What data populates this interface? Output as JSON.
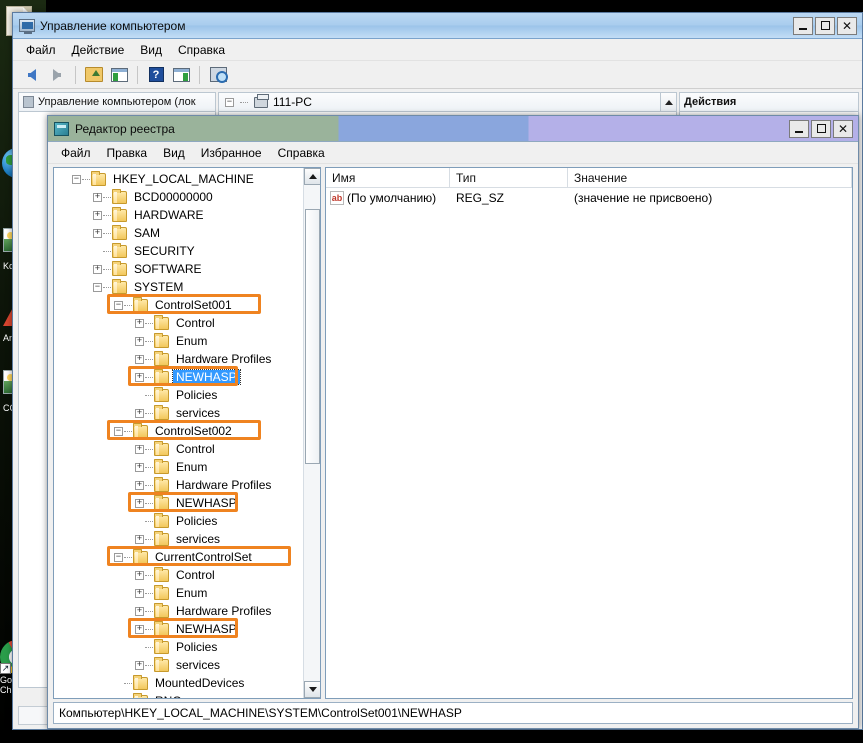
{
  "desktop": {
    "icons": [
      {
        "name": "document-icon",
        "label": "",
        "glyph": "sheet"
      },
      {
        "name": "globe-icon",
        "label": "",
        "glyph": "globe"
      },
      {
        "name": "picture-icon",
        "label": "Ko",
        "glyph": "pic"
      },
      {
        "name": "triangle-icon",
        "label": "An",
        "glyph": "tri"
      },
      {
        "name": "photo-icon",
        "label": "CC",
        "glyph": "pic"
      },
      {
        "name": "chrome-icon",
        "label": "Google Chrome",
        "glyph": "chrome"
      }
    ]
  },
  "computer_management": {
    "title": "Управление компьютером",
    "menu": [
      "Файл",
      "Действие",
      "Вид",
      "Справка"
    ],
    "toolbar": [
      "back-arrow-icon",
      "forward-arrow-icon",
      "separator",
      "up-folder-icon",
      "show-console-tree-icon",
      "separator",
      "help-icon",
      "show-action-pane-icon",
      "separator",
      "refresh-icon"
    ],
    "left_pane_header": "Управление компьютером (лок",
    "middle_pane_item": "111-PC",
    "right_pane_header": "Действия",
    "window_buttons": {
      "minimize": "_",
      "maximize": "□",
      "close": "✕"
    }
  },
  "registry_editor": {
    "title": "Редактор реестра",
    "menu": [
      "Файл",
      "Правка",
      "Вид",
      "Избранное",
      "Справка"
    ],
    "window_buttons": {
      "minimize": "_",
      "maximize": "□",
      "close": "✕"
    },
    "status_path": "Компьютер\\HKEY_LOCAL_MACHINE\\SYSTEM\\ControlSet001\\NEWHASP",
    "highlight_color": "#ef8320",
    "selection_color": "#3399ff",
    "tree": [
      {
        "label": "HKEY_LOCAL_MACHINE",
        "indent": 0,
        "expander": "-",
        "selected": false,
        "highlight": false
      },
      {
        "label": "BCD00000000",
        "indent": 1,
        "expander": "+",
        "selected": false,
        "highlight": false
      },
      {
        "label": "HARDWARE",
        "indent": 1,
        "expander": "+",
        "selected": false,
        "highlight": false
      },
      {
        "label": "SAM",
        "indent": 1,
        "expander": "+",
        "selected": false,
        "highlight": false
      },
      {
        "label": "SECURITY",
        "indent": 1,
        "expander": "",
        "selected": false,
        "highlight": false
      },
      {
        "label": "SOFTWARE",
        "indent": 1,
        "expander": "+",
        "selected": false,
        "highlight": false
      },
      {
        "label": "SYSTEM",
        "indent": 1,
        "expander": "-",
        "selected": false,
        "highlight": false
      },
      {
        "label": "ControlSet001",
        "indent": 2,
        "expander": "-",
        "selected": false,
        "highlight": true
      },
      {
        "label": "Control",
        "indent": 3,
        "expander": "+",
        "selected": false,
        "highlight": false
      },
      {
        "label": "Enum",
        "indent": 3,
        "expander": "+",
        "selected": false,
        "highlight": false
      },
      {
        "label": "Hardware Profiles",
        "indent": 3,
        "expander": "+",
        "selected": false,
        "highlight": false
      },
      {
        "label": "NEWHASP",
        "indent": 3,
        "expander": "+",
        "selected": true,
        "highlight": true
      },
      {
        "label": "Policies",
        "indent": 3,
        "expander": "",
        "selected": false,
        "highlight": false
      },
      {
        "label": "services",
        "indent": 3,
        "expander": "+",
        "selected": false,
        "highlight": false
      },
      {
        "label": "ControlSet002",
        "indent": 2,
        "expander": "-",
        "selected": false,
        "highlight": true
      },
      {
        "label": "Control",
        "indent": 3,
        "expander": "+",
        "selected": false,
        "highlight": false
      },
      {
        "label": "Enum",
        "indent": 3,
        "expander": "+",
        "selected": false,
        "highlight": false
      },
      {
        "label": "Hardware Profiles",
        "indent": 3,
        "expander": "+",
        "selected": false,
        "highlight": false
      },
      {
        "label": "NEWHASP",
        "indent": 3,
        "expander": "+",
        "selected": false,
        "highlight": true
      },
      {
        "label": "Policies",
        "indent": 3,
        "expander": "",
        "selected": false,
        "highlight": false
      },
      {
        "label": "services",
        "indent": 3,
        "expander": "+",
        "selected": false,
        "highlight": false
      },
      {
        "label": "CurrentControlSet",
        "indent": 2,
        "expander": "-",
        "selected": false,
        "highlight": true
      },
      {
        "label": "Control",
        "indent": 3,
        "expander": "+",
        "selected": false,
        "highlight": false
      },
      {
        "label": "Enum",
        "indent": 3,
        "expander": "+",
        "selected": false,
        "highlight": false
      },
      {
        "label": "Hardware Profiles",
        "indent": 3,
        "expander": "+",
        "selected": false,
        "highlight": false
      },
      {
        "label": "NEWHASP",
        "indent": 3,
        "expander": "+",
        "selected": false,
        "highlight": true
      },
      {
        "label": "Policies",
        "indent": 3,
        "expander": "",
        "selected": false,
        "highlight": false
      },
      {
        "label": "services",
        "indent": 3,
        "expander": "+",
        "selected": false,
        "highlight": false
      },
      {
        "label": "MountedDevices",
        "indent": 2,
        "expander": "",
        "selected": false,
        "highlight": false
      },
      {
        "label": "RNG",
        "indent": 2,
        "expander": "",
        "selected": false,
        "highlight": false
      }
    ],
    "values": {
      "columns": [
        "Имя",
        "Тип",
        "Значение"
      ],
      "rows": [
        {
          "name": "(По умолчанию)",
          "type": "REG_SZ",
          "value": "(значение не присвоено)",
          "icon": "ab"
        }
      ]
    }
  }
}
